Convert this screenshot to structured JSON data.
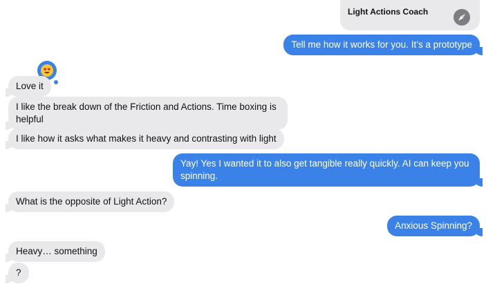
{
  "link_preview": {
    "title": "Light Actions Coach",
    "icon": "compass-icon"
  },
  "messages": [
    {
      "id": "m1",
      "from": "me",
      "text": "Tell me how it works for you. It’s a prototype"
    },
    {
      "id": "m2",
      "from": "them",
      "text": "Love it",
      "tapback": "heart-eyes-emoji"
    },
    {
      "id": "m3",
      "from": "them",
      "text": "I like the break down of the Friction and Actions. Time boxing is helpful"
    },
    {
      "id": "m4",
      "from": "them",
      "text": "I like how it asks what makes it heavy and contrasting with light"
    },
    {
      "id": "m5",
      "from": "me",
      "text": "Yay! Yes I wanted it to also get tangible really quickly. AI can keep you spinning."
    },
    {
      "id": "m6",
      "from": "them",
      "text": "What is the opposite of Light Action?"
    },
    {
      "id": "m7",
      "from": "me",
      "text": "Anxious Spinning?"
    },
    {
      "id": "m8",
      "from": "them",
      "text": "Heavy… something"
    },
    {
      "id": "m9",
      "from": "them",
      "text": "?"
    }
  ],
  "colors": {
    "outgoing": "#3b82e8",
    "incoming": "#e9e9eb",
    "incoming_text": "#111111",
    "outgoing_text": "#ffffff"
  }
}
